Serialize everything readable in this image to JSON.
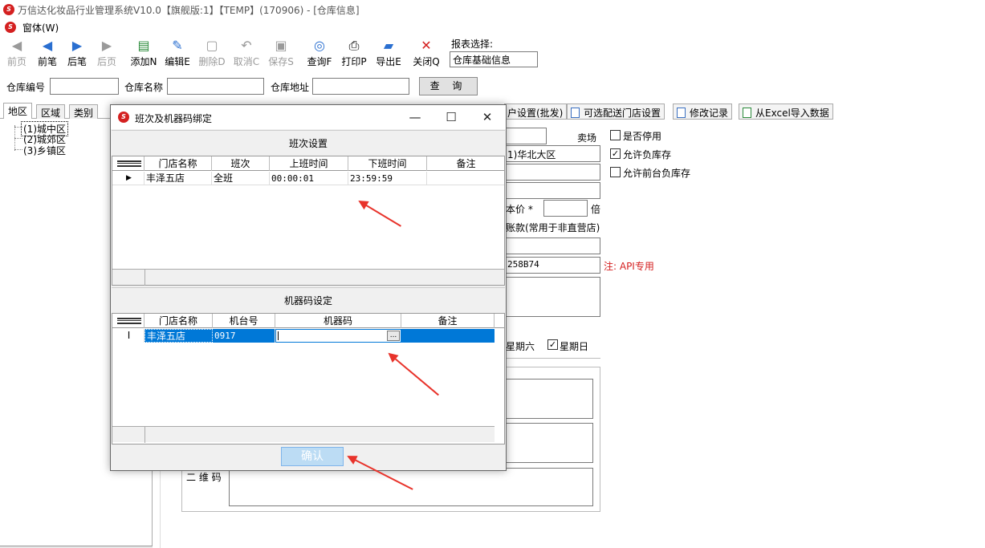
{
  "window": {
    "title": "万信达化妆品行业管理系统V10.0【旗舰版:1】【TEMP】(170906) - [仓库信息]"
  },
  "menu": {
    "window_label": "窗体(W)"
  },
  "toolbar": {
    "first": "前页",
    "prev": "前笔",
    "next": "后笔",
    "last": "后页",
    "add": "添加N",
    "edit": "编辑E",
    "delete": "删除D",
    "cancel": "取消C",
    "save": "保存S",
    "query": "查询F",
    "print": "打印P",
    "export": "导出E",
    "close": "关闭Q",
    "report_label": "报表选择:",
    "report_value": "仓库基础信息"
  },
  "filter": {
    "code_label": "仓库编号",
    "name_label": "仓库名称",
    "addr_label": "仓库地址",
    "query_button": "查 询"
  },
  "left_tabs": [
    "地区",
    "区域",
    "类别"
  ],
  "tree": [
    "(1)城中区",
    "(2)城郊区",
    "(3)乡镇区"
  ],
  "right_tabs": {
    "tab1": "户设置(批发)",
    "tab2": "可选配送门店设置",
    "tab3": "修改记录",
    "tab4": "从Excel导入数据"
  },
  "form": {
    "store_label": "卖场",
    "region_value": "1)华北大区",
    "cost_label": "本价 *",
    "times_label": "倍",
    "account_label": "账款(常用于非直营店)",
    "api_value": "258B74",
    "api_note": "注: API专用",
    "disabled_label": "是否停用",
    "allow_negative_label": "允许负库存",
    "allow_front_negative_label": "允许前台负库存",
    "saturday_label": "星期六",
    "sunday_label": "星期日",
    "qr_label": "二 维 码"
  },
  "dialog": {
    "title": "班次及机器码绑定",
    "shift_section": "班次设置",
    "shift_columns": [
      "门店名称",
      "班次",
      "上班时间",
      "下班时间",
      "备注"
    ],
    "shift_rows": [
      {
        "store": "丰泽五店",
        "shift": "全班",
        "start": "00:00:01",
        "end": "23:59:59",
        "note": ""
      }
    ],
    "machine_section": "机器码设定",
    "machine_columns": [
      "门店名称",
      "机台号",
      "机器码",
      "备注"
    ],
    "machine_rows": [
      {
        "store": "丰泽五店",
        "machine_no": "0917",
        "code": "",
        "note": ""
      }
    ],
    "confirm": "确认",
    "ellipsis": "..."
  },
  "colors": {
    "accent": "#0078d7",
    "arrow": "#e8332b",
    "logo": "#d42020"
  }
}
